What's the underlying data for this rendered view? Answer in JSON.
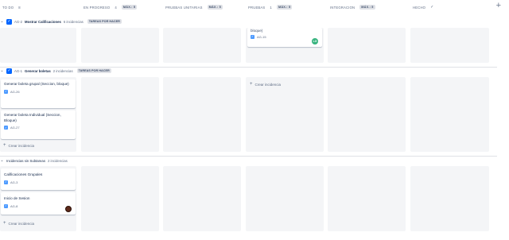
{
  "columns": [
    {
      "name": "TO DO",
      "count": "8",
      "max": ""
    },
    {
      "name": "EN PROGRESO",
      "count": "4",
      "max": "MÁX.: 5"
    },
    {
      "name": "PRUEBAS UNITARIAS",
      "count": "",
      "max": "MÁX.: 5"
    },
    {
      "name": "PRUEBAS",
      "count": "1",
      "max": "MÁX.: 5"
    },
    {
      "name": "INTEGRACION",
      "count": "",
      "max": "MÁX.: 5"
    },
    {
      "name": "HECHO",
      "count": "",
      "max": ""
    }
  ],
  "swimlanes": [
    {
      "key": "AG-2",
      "name": "Mostrar Calificaciones",
      "count": "6 incidencias",
      "status": "TAREAS POR HACER"
    },
    {
      "key": "AG-1",
      "name": "Generar boletas",
      "count": "2 incidencias",
      "status": "TAREAS POR HACER"
    },
    {
      "key": "",
      "name": "Incidencias sin Subtareas",
      "count": "2 incidencias",
      "status": ""
    }
  ],
  "cards": {
    "pruebas_card": {
      "title": "bloque)",
      "key": "AG-15",
      "avatar": "LG"
    },
    "boleta_grupal": {
      "title": "Generar boleta grupal (Seccion, bloque)",
      "key": "AG-26"
    },
    "boleta_individual": {
      "title": "Generar boleta Individual (Seccion, Bloque)",
      "key": "AG-27"
    },
    "calif_grupales": {
      "title": "Calificaciones Grupales",
      "key": "AG-3"
    },
    "inicio_sesion": {
      "title": "Inicio de Sesion",
      "key": "AG-8"
    }
  },
  "labels": {
    "create_issue": "Crear incidencia"
  },
  "colors": {
    "accent": "#0065ff",
    "column_bg": "#f4f5f7"
  }
}
